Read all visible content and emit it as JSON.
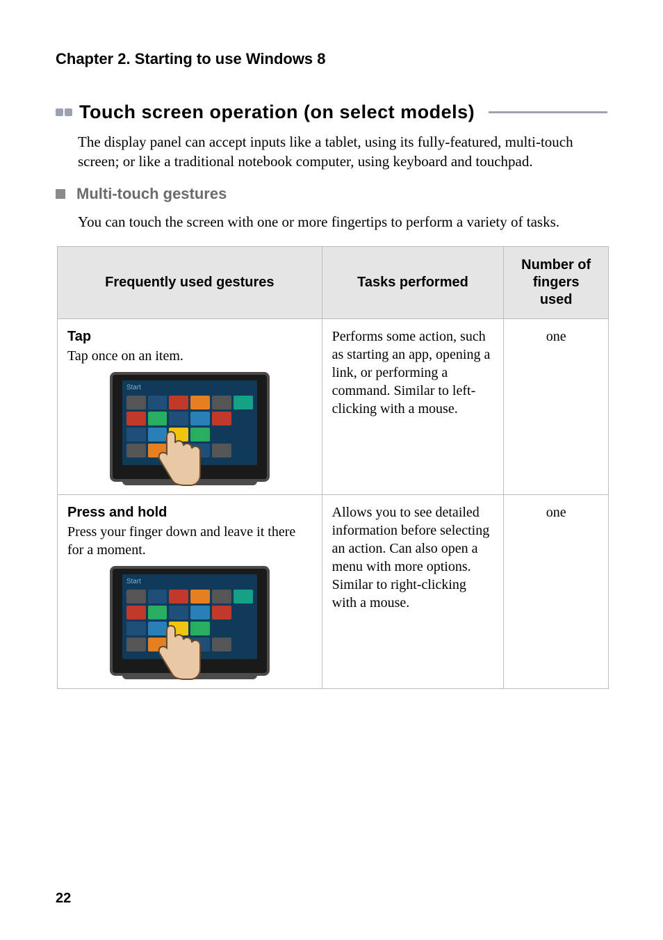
{
  "chapterTitle": "Chapter 2. Starting to use Windows 8",
  "section": {
    "title": "Touch screen operation (on select models)",
    "intro": "The display panel can accept inputs like a tablet, using its fully-featured, multi-touch screen; or like a traditional notebook computer, using keyboard and touchpad."
  },
  "subsection": {
    "title": "Multi-touch gestures",
    "intro": "You can touch the screen with one or more fingertips to perform a variety of tasks."
  },
  "table": {
    "headers": {
      "gestures": "Frequently used gestures",
      "tasks": "Tasks performed",
      "fingers": "Number of fingers used"
    },
    "rows": [
      {
        "name": "Tap",
        "desc": "Tap once on an item.",
        "illustrationLabel": "Start",
        "task": "Performs some action, such as starting an app, opening a link, or performing a command. Similar to left-clicking with a mouse.",
        "fingers": "one"
      },
      {
        "name": "Press and hold",
        "desc": "Press your finger down and leave it there for a moment.",
        "illustrationLabel": "Start",
        "task": "Allows you to see detailed information before selecting an action. Can also open a menu with more options. Similar to right-clicking with a mouse.",
        "fingers": "one"
      }
    ]
  },
  "pageNumber": "22"
}
